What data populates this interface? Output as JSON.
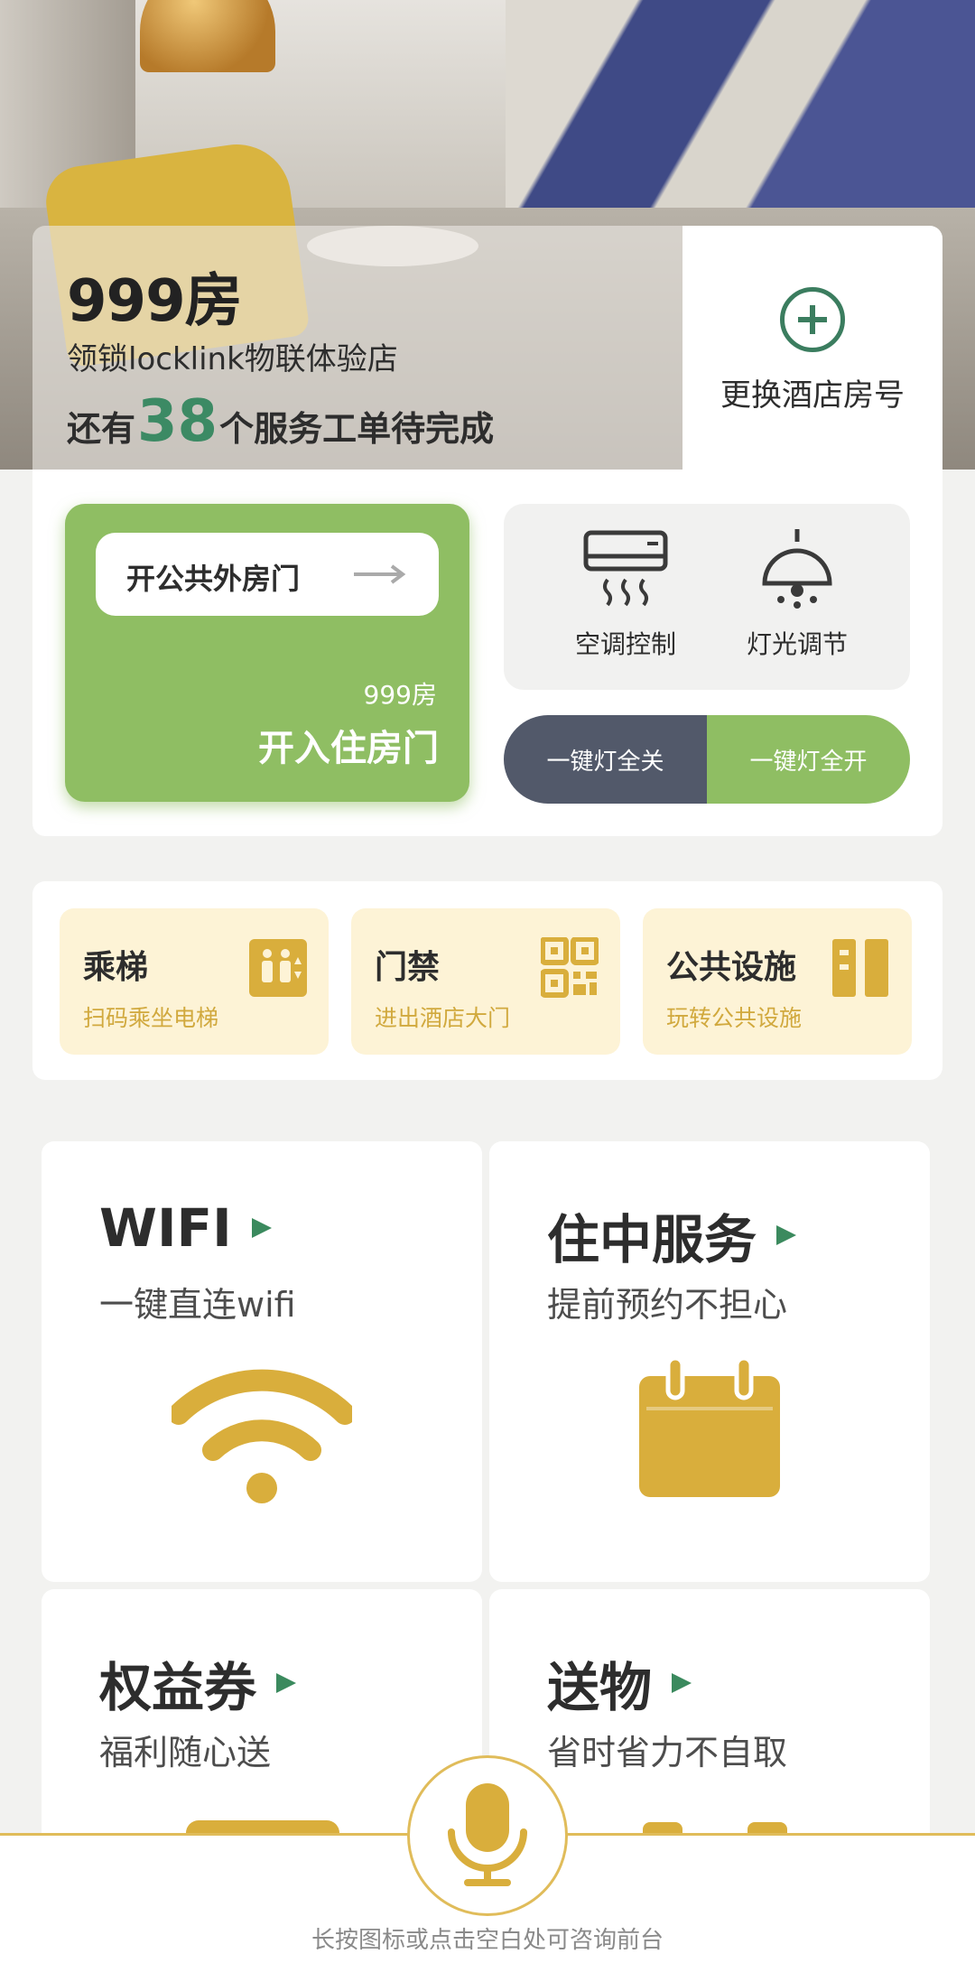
{
  "header": {
    "room_title": "999房",
    "store_name": "领锁locklink物联体验店",
    "pending_prefix": "还有",
    "pending_count": "38",
    "pending_suffix": "个服务工单待完成",
    "change_label": "更换酒店房号"
  },
  "doors": {
    "public_door_label": "开公共外房门",
    "room_number": "999房",
    "enter_door_label": "开入住房门"
  },
  "controls": {
    "ac_label": "空调控制",
    "light_label": "灯光调节",
    "all_off_label": "一键灯全关",
    "all_on_label": "一键灯全开"
  },
  "quick_services": [
    {
      "title": "乘梯",
      "subtitle": "扫码乘坐电梯",
      "icon": "elevator-icon"
    },
    {
      "title": "门禁",
      "subtitle": "进出酒店大门",
      "icon": "qr-code-icon"
    },
    {
      "title": "公共设施",
      "subtitle": "玩转公共设施",
      "icon": "facilities-icon"
    }
  ],
  "tiles": [
    {
      "title": "WIFI",
      "subtitle": "一键直连wifi",
      "icon": "wifi-icon"
    },
    {
      "title": "住中服务",
      "subtitle": "提前预约不担心",
      "icon": "calendar-icon"
    },
    {
      "title": "权益券",
      "subtitle": "福利随心送",
      "icon": "coupon-icon"
    },
    {
      "title": "送物",
      "subtitle": "省时省力不自取",
      "icon": "delivery-icon"
    }
  ],
  "footer": {
    "hint": "长按图标或点击空白处可咨询前台",
    "mic_icon": "microphone-icon"
  },
  "colors": {
    "green": "#8fbe63",
    "dark_green": "#3b7d5f",
    "gold": "#d9ae3c",
    "slate": "#52596a",
    "cream": "#fdf3d6"
  }
}
